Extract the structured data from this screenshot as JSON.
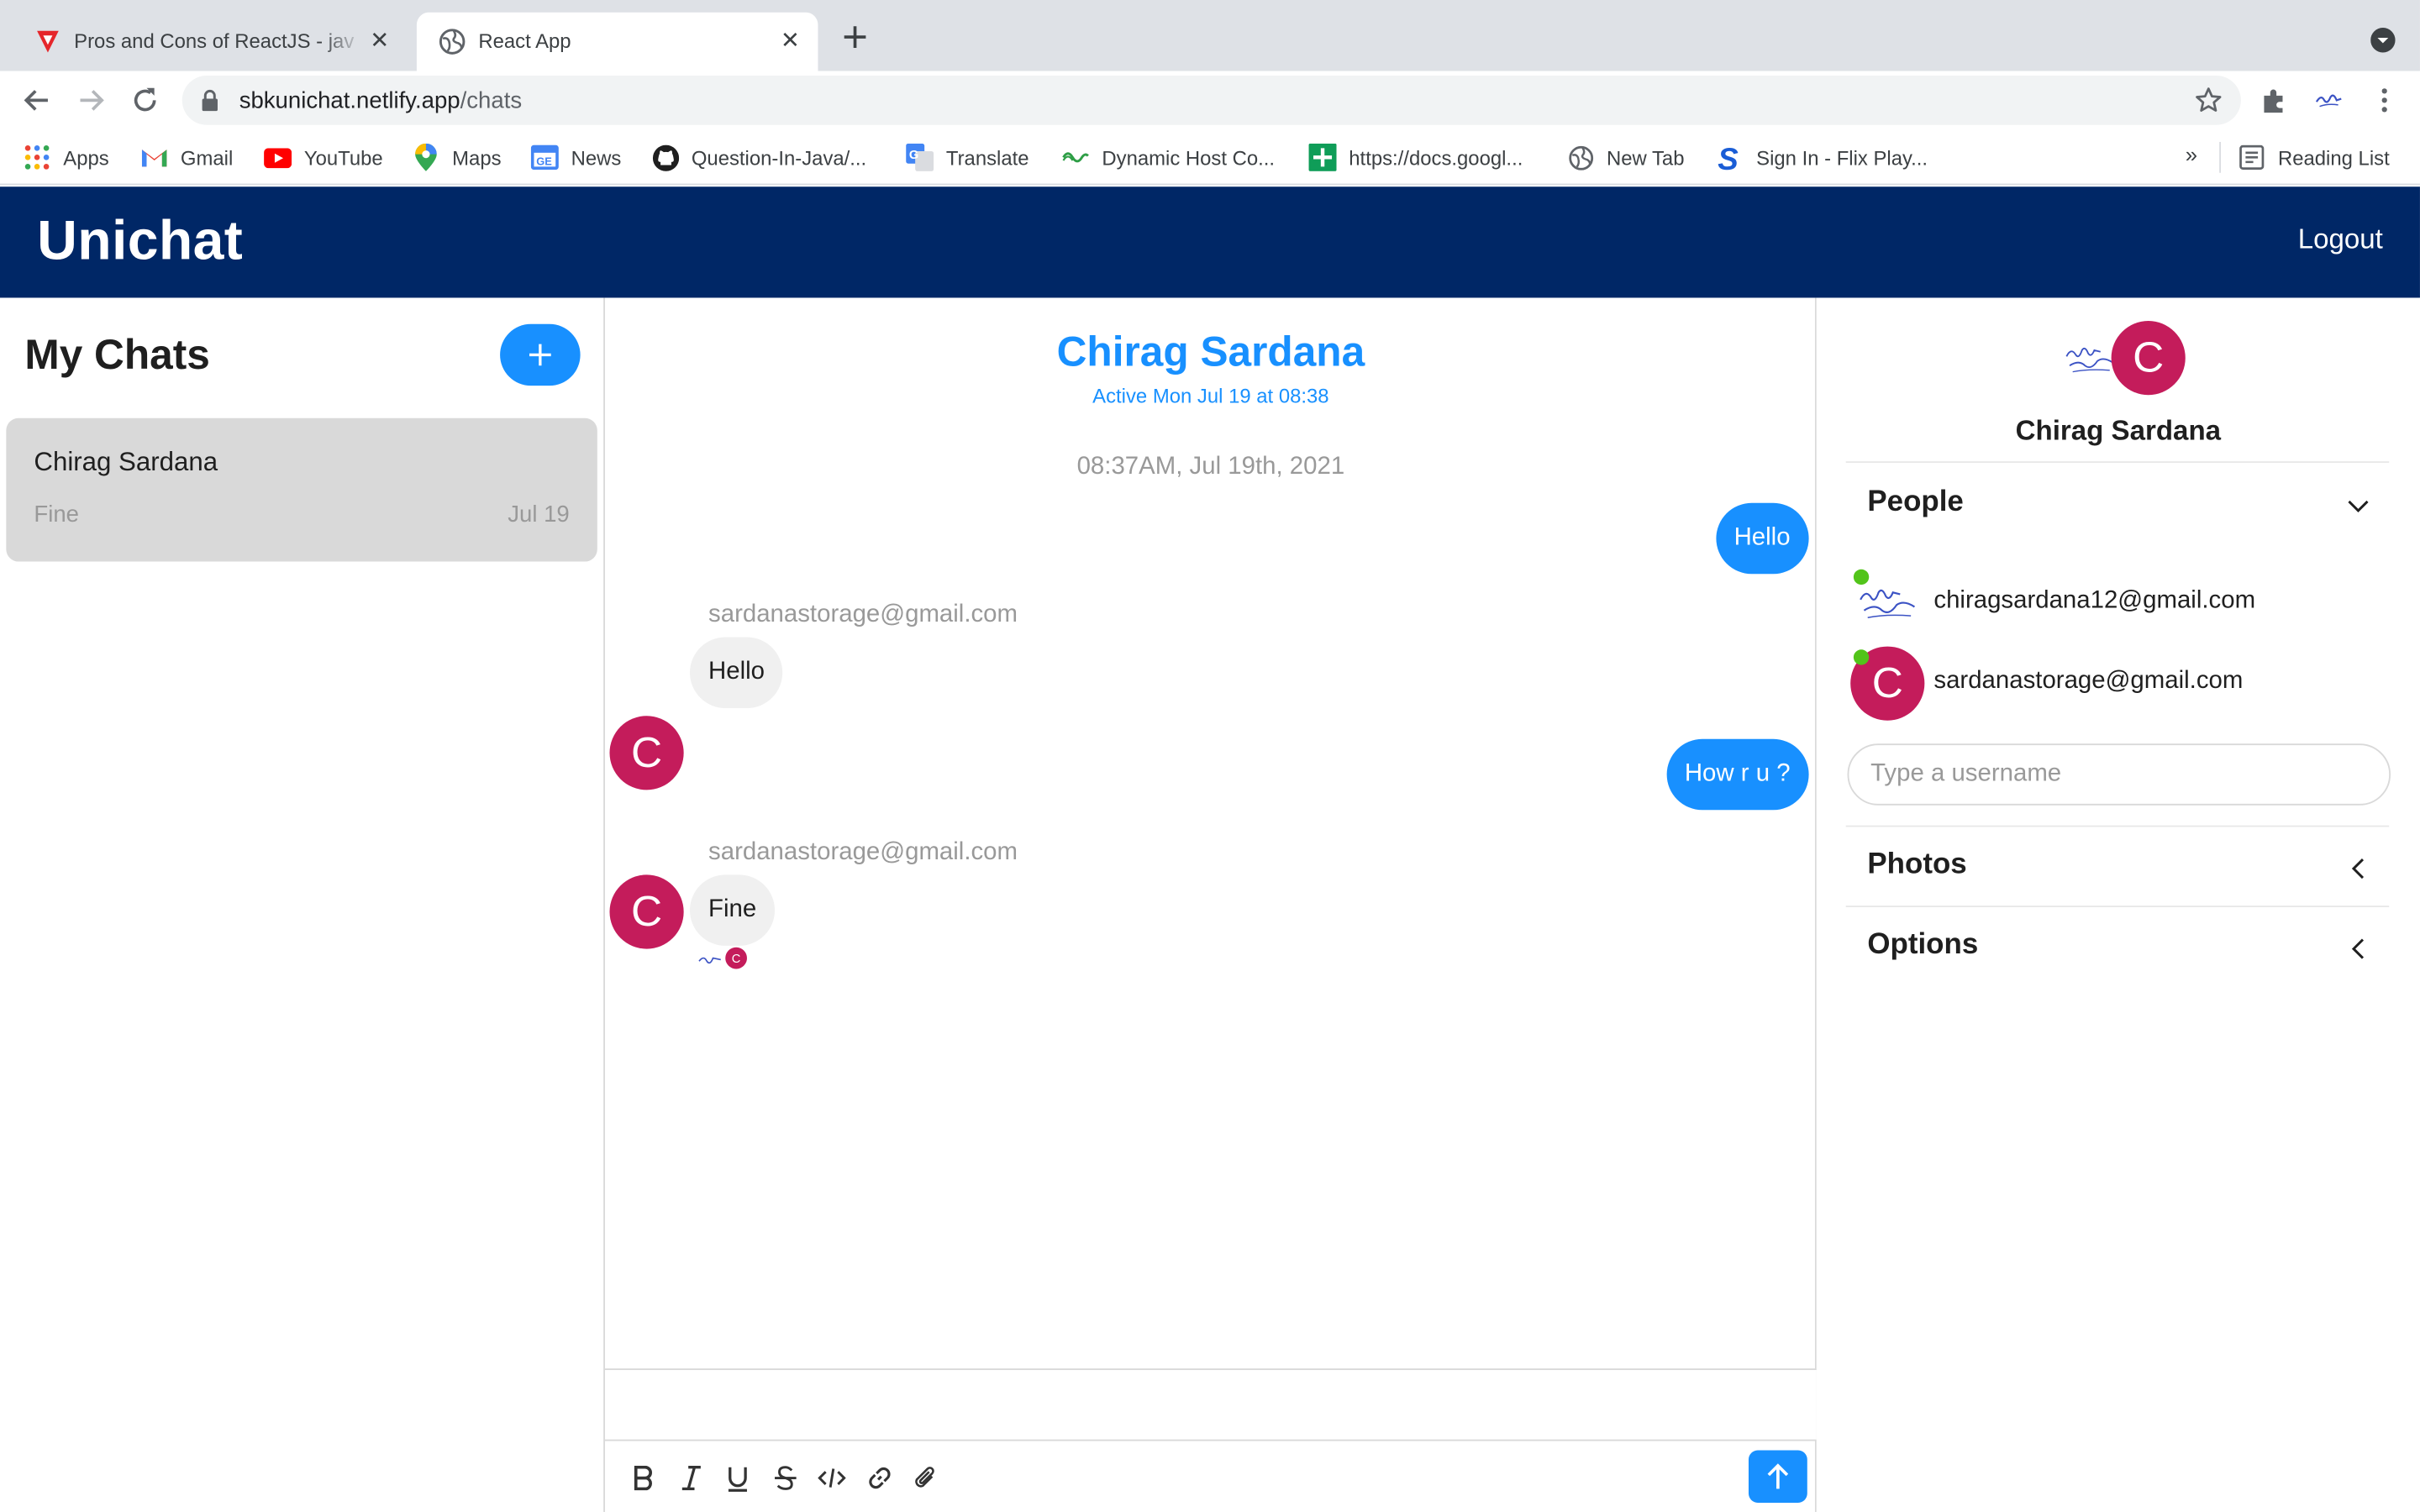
{
  "browser": {
    "tabs": [
      {
        "title": "Pros and Cons of ReactJS - jav"
      },
      {
        "title": "React App"
      }
    ],
    "url_host": "sbkunichat.netlify.app",
    "url_path": "/chats",
    "bookmarks": [
      {
        "label": "Apps",
        "icon": "apps-grid-icon"
      },
      {
        "label": "Gmail",
        "icon": "gmail-icon"
      },
      {
        "label": "YouTube",
        "icon": "youtube-icon"
      },
      {
        "label": "Maps",
        "icon": "maps-icon"
      },
      {
        "label": "News",
        "icon": "news-icon"
      },
      {
        "label": "Question-In-Java/...",
        "icon": "github-icon"
      },
      {
        "label": "Translate",
        "icon": "translate-icon"
      },
      {
        "label": "Dynamic Host Co...",
        "icon": "dynamic-host-icon"
      },
      {
        "label": "https://docs.googl...",
        "icon": "sheets-icon"
      },
      {
        "label": "New Tab",
        "icon": "globe-icon"
      },
      {
        "label": "Sign In - Flix Play...",
        "icon": "s-logo-icon"
      }
    ],
    "more_bookmarks": "»",
    "reading_list": "Reading List"
  },
  "app": {
    "brand": "Unichat",
    "logout": "Logout",
    "header_color": "#002766",
    "accent": "#1890ff"
  },
  "chat_list": {
    "title": "My Chats",
    "chats": [
      {
        "name": "Chirag Sardana",
        "last_message": "Fine",
        "date": "Jul 19"
      }
    ]
  },
  "feed": {
    "title": "Chirag Sardana",
    "subtitle": "Active Mon Jul 19 at 08:38",
    "date_divider": "08:37AM, Jul 19th, 2021",
    "messages": [
      {
        "from": "me",
        "text": "Hello"
      },
      {
        "from": "sardanastorage@gmail.com",
        "text": "Hello",
        "avatar": "C"
      },
      {
        "from": "me",
        "text": "How r u ?"
      },
      {
        "from": "sardanastorage@gmail.com",
        "text": "Fine",
        "avatar": "C"
      }
    ],
    "read_avatar": "C",
    "formatting": [
      "bold-icon",
      "italic-icon",
      "underline-icon",
      "strikethrough-icon",
      "code-icon",
      "link-icon",
      "attachment-icon"
    ]
  },
  "settings": {
    "avatar": "C",
    "title": "Chirag Sardana",
    "people_label": "People",
    "people": [
      {
        "email": "chiragsardana12@gmail.com",
        "online": true
      },
      {
        "email": "sardanastorage@gmail.com",
        "online": true,
        "avatar": "C"
      }
    ],
    "username_placeholder": "Type a username",
    "photos_label": "Photos",
    "options_label": "Options"
  }
}
